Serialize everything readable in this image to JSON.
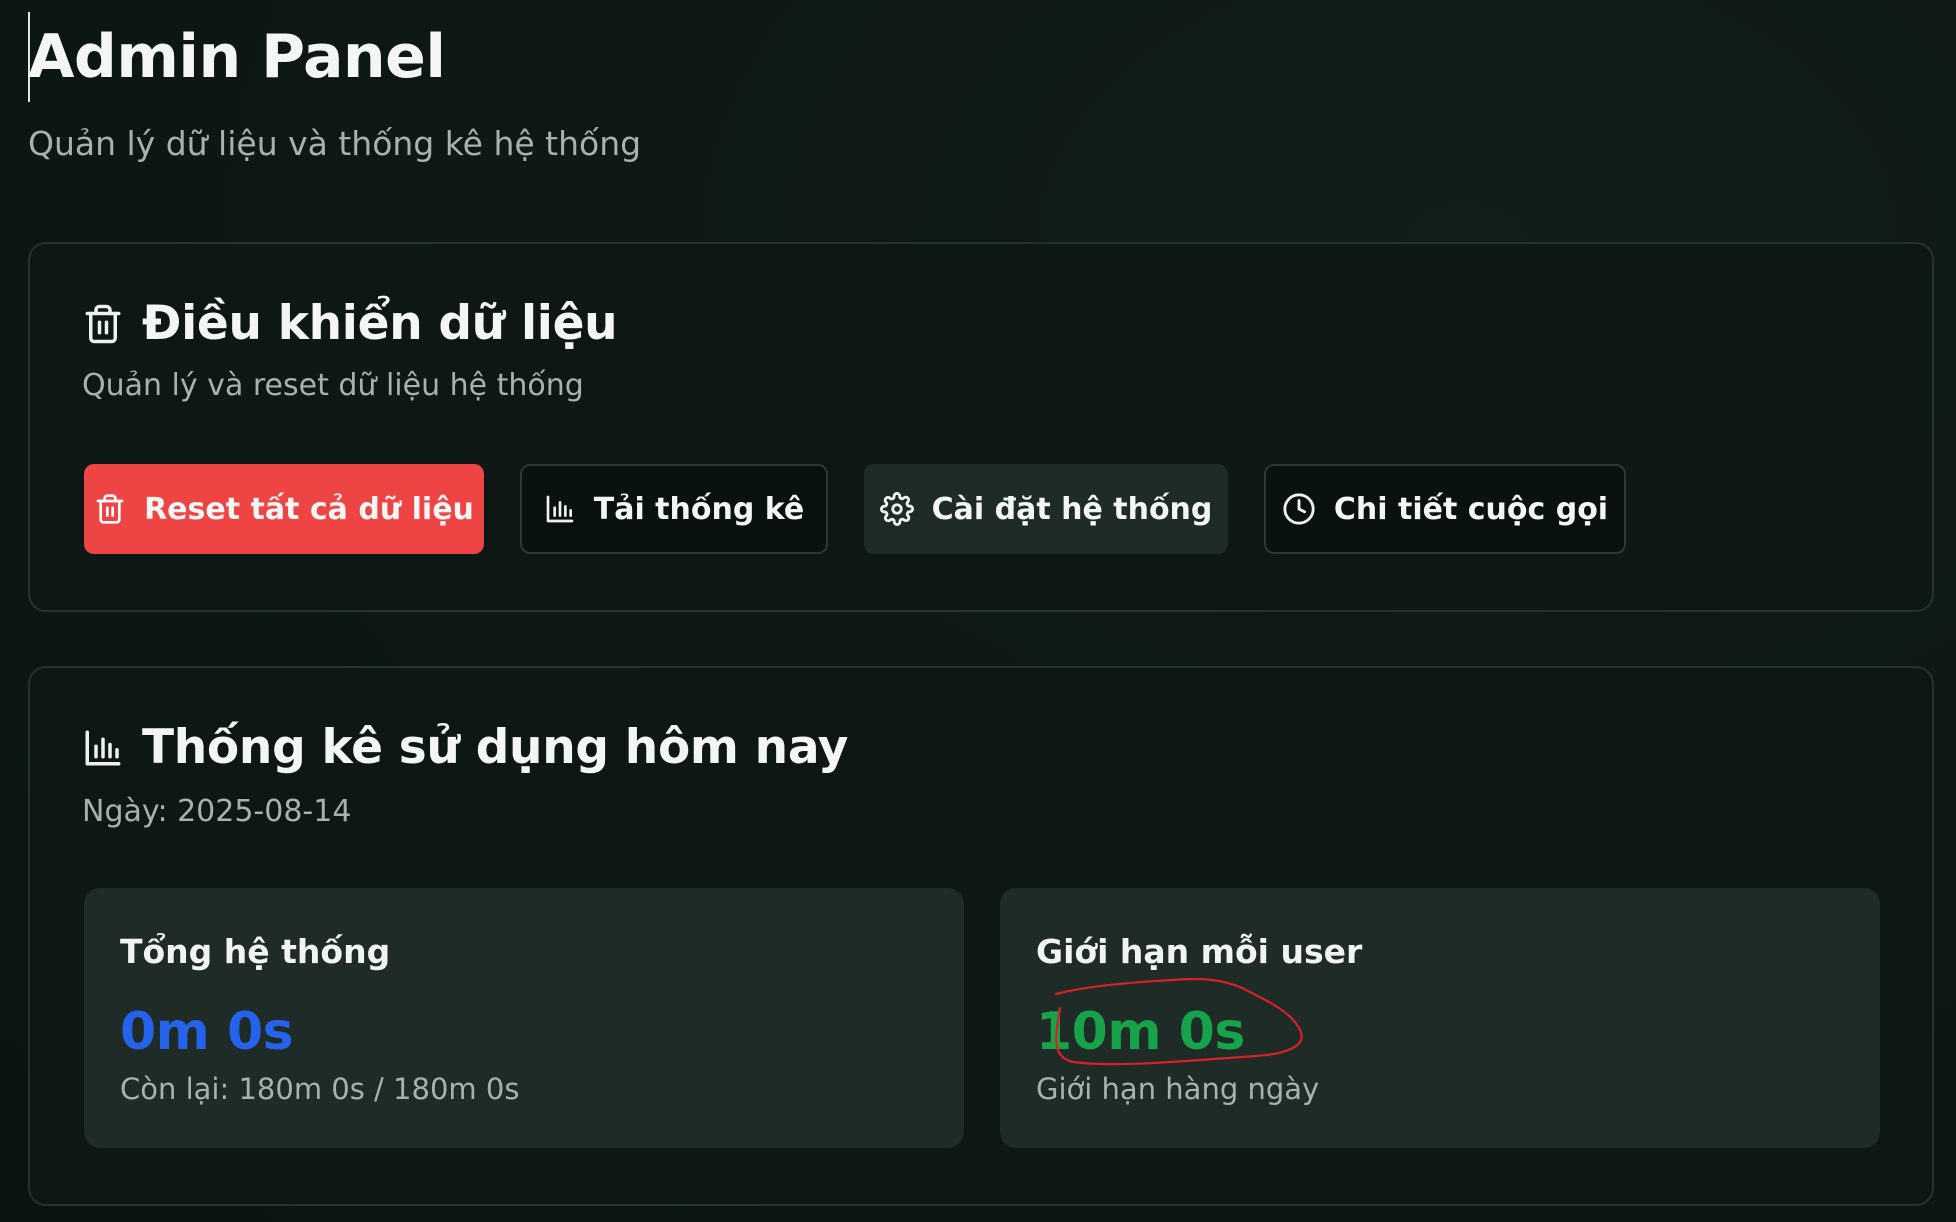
{
  "header": {
    "title": "Admin Panel",
    "subtitle": "Quản lý dữ liệu và thống kê hệ thống"
  },
  "data_control": {
    "icon": "trash-icon",
    "title": "Điều khiển dữ liệu",
    "description": "Quản lý và reset dữ liệu hệ thống",
    "buttons": {
      "reset": {
        "label": "Reset tất cả dữ liệu",
        "icon": "trash-icon",
        "color": "#ef4444"
      },
      "download_stats": {
        "label": "Tải thống kê",
        "icon": "bar-chart-icon"
      },
      "settings": {
        "label": "Cài đặt hệ thống",
        "icon": "gear-icon"
      },
      "call_details": {
        "label": "Chi tiết cuộc gọi",
        "icon": "clock-icon"
      }
    }
  },
  "usage_stats": {
    "icon": "bar-chart-icon",
    "title": "Thống kê sử dụng hôm nay",
    "date": "Ngày: 2025-08-14",
    "total": {
      "label": "Tổng hệ thống",
      "value": "0m 0s",
      "note": "Còn lại: 180m 0s / 180m 0s",
      "color": "#2563eb"
    },
    "per_user": {
      "label": "Giới hạn mỗi user",
      "value": "10m 0s",
      "note": "Giới hạn hàng ngày",
      "color": "#16a34a"
    }
  },
  "colors": {
    "background": "#0d1713",
    "card_border": "#25332d",
    "stat_box": "#1f2b27",
    "annotation": "#d8202a"
  }
}
